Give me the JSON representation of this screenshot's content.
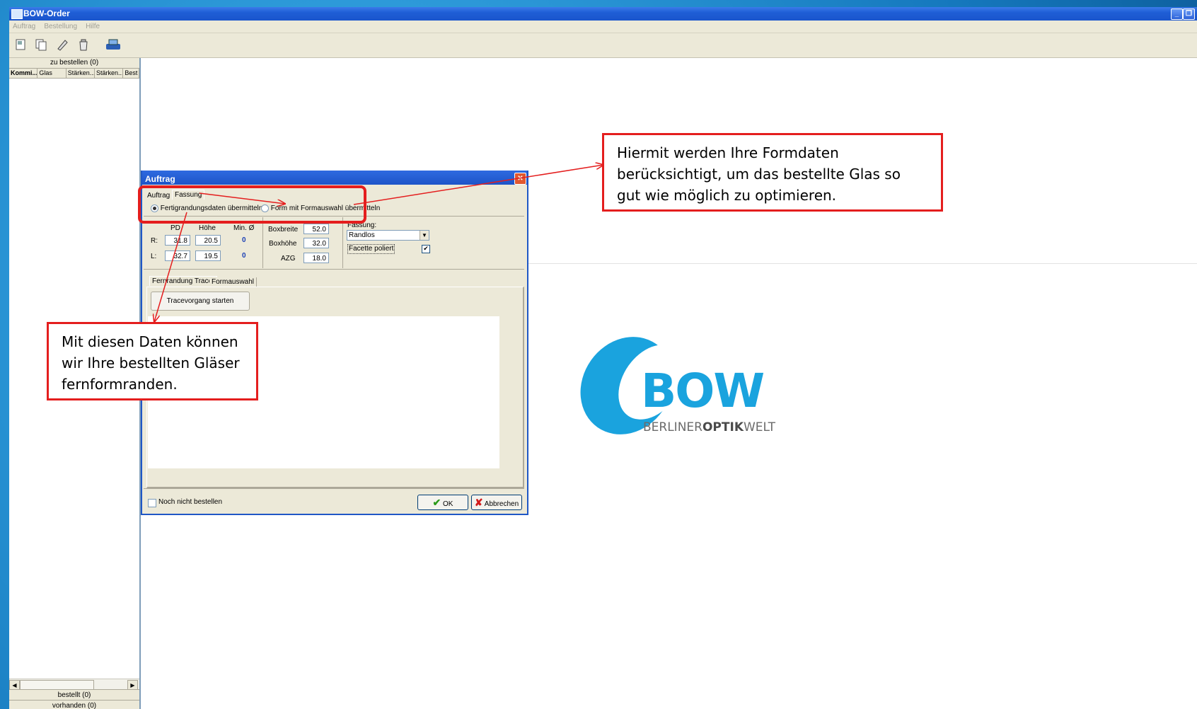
{
  "window": {
    "title": "BOW-Order",
    "menu": [
      "Auftrag",
      "Bestellung",
      "Hilfe"
    ],
    "toolbar_icons": [
      "new-order-icon",
      "copy-order-icon",
      "edit-icon",
      "delete-icon",
      "send-order-icon"
    ]
  },
  "left_panel": {
    "header": "zu bestellen (0)",
    "columns": [
      "Kommi...",
      "Glas",
      "Stärken...",
      "Stärken...",
      "Best"
    ],
    "footer_ordered": "bestellt (0)",
    "footer_available": "vorhanden (0)"
  },
  "dialog": {
    "title": "Auftrag",
    "tabs": [
      "Auftrag",
      "Fassung"
    ],
    "radio_1": "Fertigrandungsdaten übermitteln",
    "radio_2": "Form mit Formauswahl übermitteln",
    "col_pd": "PD",
    "col_hoehe": "Höhe",
    "col_min": "Min. Ø",
    "row_r": "R:",
    "row_l": "L:",
    "r_pd": "31.8",
    "r_hoehe": "20.5",
    "r_min": "0",
    "l_pd": "32.7",
    "l_hoehe": "19.5",
    "l_min": "0",
    "boxbreite_label": "Boxbreite",
    "boxbreite": "52.0",
    "boxhoehe_label": "Boxhöhe",
    "boxhoehe": "32.0",
    "azg_label": "AZG",
    "azg": "18.0",
    "fassung_label": "Fassung:",
    "fassung_value": "Randlos",
    "facette_label": "Facette poliert",
    "subtabs": [
      "Fernrandung Tracer",
      "Formauswahl"
    ],
    "trace_button": "Tracevorgang starten",
    "noch_nicht_label": "Noch nicht bestellen",
    "ok": "OK",
    "cancel": "Abbrechen"
  },
  "callouts": {
    "right": "Hiermit werden Ihre Formdaten berücksichtigt, um das bestellte Glas so gut wie möglich zu optimieren.",
    "left": "Mit diesen Daten können wir Ihre bestellten Gläser fernformranden."
  },
  "logo": {
    "mark": "BOW",
    "tag_1": "BERLINER",
    "tag_2": "OPTIK",
    "tag_3": "WELT"
  },
  "colors": {
    "callout_border": "#e41e1e",
    "logo_blue": "#1aa3de"
  }
}
